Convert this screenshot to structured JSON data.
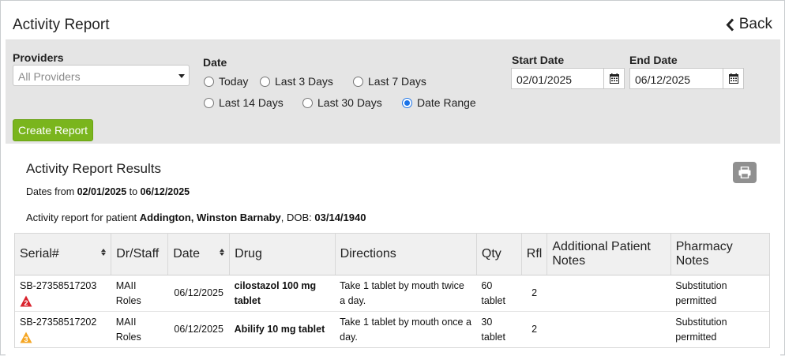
{
  "header": {
    "title": "Activity Report",
    "back_label": "Back"
  },
  "filters": {
    "providers_label": "Providers",
    "providers_placeholder": "All Providers",
    "date_label": "Date",
    "date_options": [
      {
        "label": "Today",
        "selected": false
      },
      {
        "label": "Last 3 Days",
        "selected": false
      },
      {
        "label": "Last 7 Days",
        "selected": false
      },
      {
        "label": "Last 14 Days",
        "selected": false
      },
      {
        "label": "Last 30 Days",
        "selected": false
      },
      {
        "label": "Date Range",
        "selected": true
      }
    ],
    "start_date_label": "Start Date",
    "start_date_value": "02/01/2025",
    "end_date_label": "End Date",
    "end_date_value": "06/12/2025",
    "create_report_label": "Create Report"
  },
  "results": {
    "title": "Activity Report Results",
    "dates_prefix": "Dates from ",
    "dates_from": "02/01/2025",
    "dates_mid": " to ",
    "dates_to": "06/12/2025",
    "patient_prefix": "Activity report for patient ",
    "patient_name": "Addington, Winston Barnaby",
    "dob_prefix": ", DOB: ",
    "dob": "03/14/1940",
    "columns": [
      "Serial#",
      "Dr/Staff",
      "Date",
      "Drug",
      "Directions",
      "Qty",
      "Rfl",
      "Additional Patient Notes",
      "Pharmacy Notes"
    ],
    "rows": [
      {
        "serial": "SB-27358517203",
        "badge": "2",
        "badge_color": "#d9232d",
        "staff": "MAII Roles",
        "date": "06/12/2025",
        "drug": "cilostazol 100 mg tablet",
        "directions": "Take 1 tablet by mouth twice a day.",
        "qty": "60 tablet",
        "rfl": "2",
        "patient_notes": "",
        "pharmacy_notes": "Substitution permitted"
      },
      {
        "serial": "SB-27358517202",
        "badge": "3",
        "badge_color": "#f5a623",
        "staff": "MAII Roles",
        "date": "06/12/2025",
        "drug": "Abilify 10 mg tablet",
        "directions": "Take 1 tablet by mouth once a day.",
        "qty": "30 tablet",
        "rfl": "2",
        "patient_notes": "",
        "pharmacy_notes": "Substitution permitted"
      }
    ]
  },
  "icons": {
    "back": "chevron-left-icon",
    "calendar": "calendar-icon",
    "print": "print-icon",
    "warning": "warning-triangle-icon",
    "dropdown": "caret-down-icon",
    "sort": "sort-icon"
  }
}
